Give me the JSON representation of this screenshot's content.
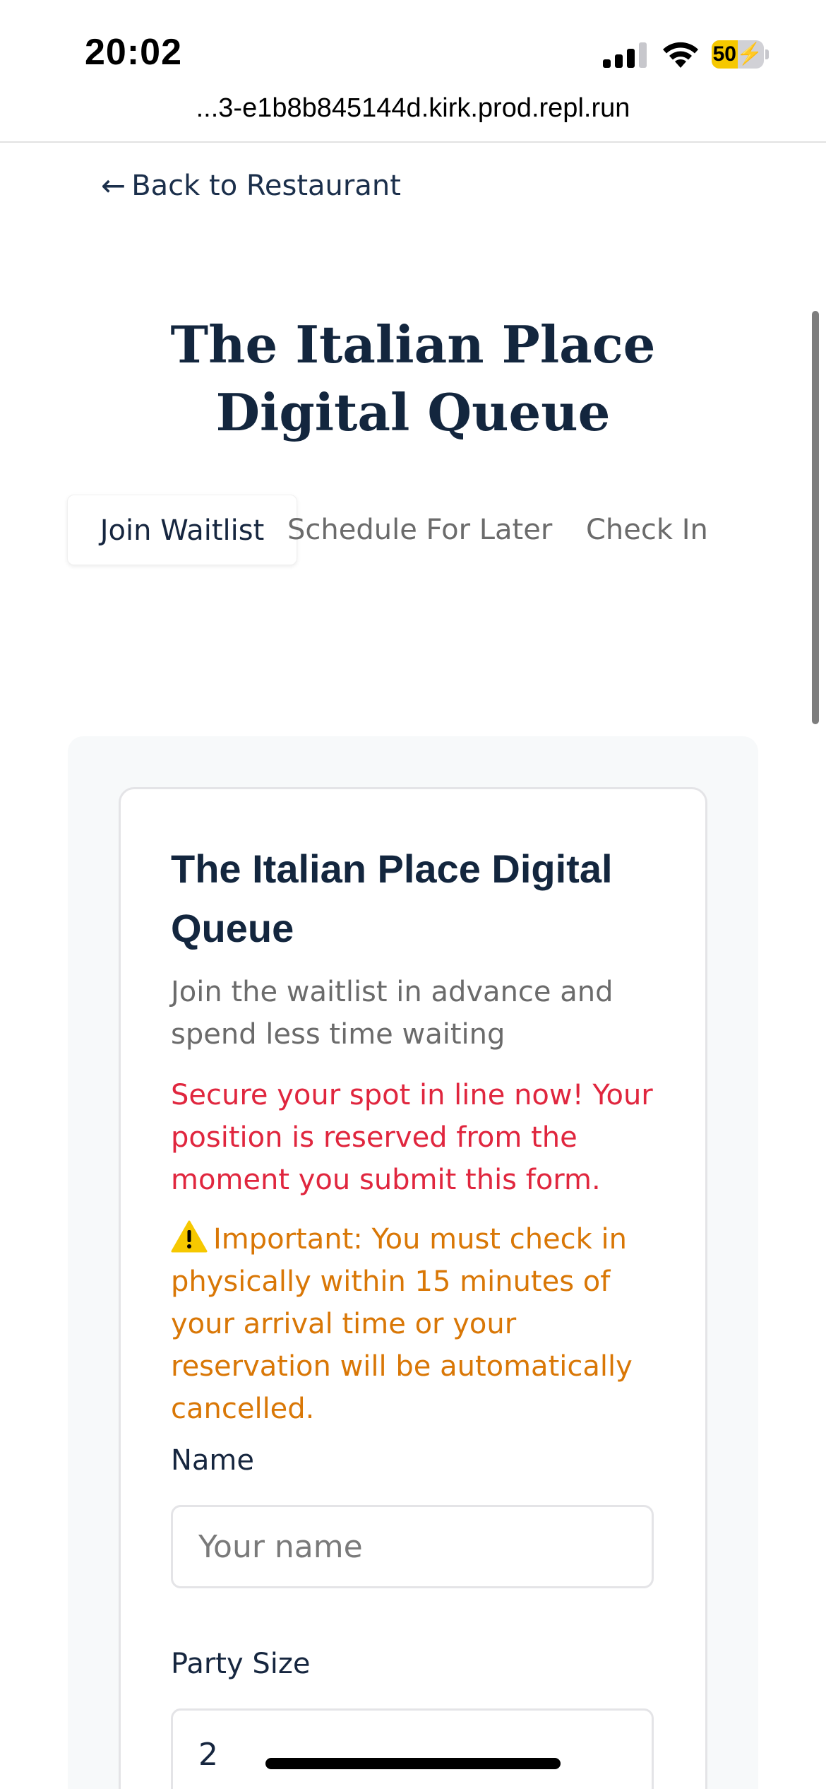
{
  "status_bar": {
    "time": "20:02",
    "battery": "50",
    "battery_level": 0.5,
    "icons": [
      "signal-icon",
      "wifi-icon",
      "battery-charging-icon"
    ]
  },
  "browser": {
    "url": "...3-e1b8b845144d.kirk.prod.repl.run"
  },
  "nav": {
    "back_label": "Back to Restaurant",
    "back_icon": "arrow-left-icon"
  },
  "page": {
    "title": "The Italian Place Digital Queue"
  },
  "tabs": [
    {
      "label": "Join Waitlist",
      "active": true
    },
    {
      "label": "Schedule For Later",
      "active": false
    },
    {
      "label": "Check In",
      "active": false
    }
  ],
  "card": {
    "title": "The Italian Place Digital Queue",
    "subtitle": "Join the waitlist in advance and spend less time waiting",
    "notice": "Secure your spot in line now! Your position is reserved from the moment you submit this form.",
    "warning": "Important: You must check in physically within 15 minutes of your arrival time or your reservation will be automatically cancelled.",
    "warning_icon": "warning-icon"
  },
  "form": {
    "name_label": "Name",
    "name_placeholder": "Your name",
    "name_value": "",
    "party_label": "Party Size",
    "party_value": "2"
  },
  "colors": {
    "primary": "#13263e",
    "danger": "#e0263e",
    "warning": "#d97706",
    "muted": "#6b6b6b",
    "panel_bg": "#f7f9fa"
  }
}
